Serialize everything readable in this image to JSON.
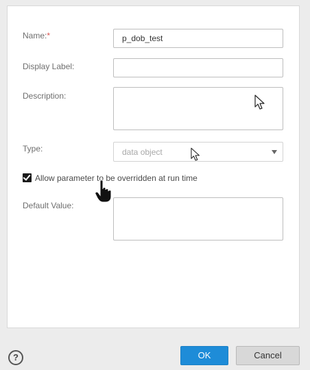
{
  "form": {
    "name_label": "Name:",
    "name_required_marker": "*",
    "name_value": "p_dob_test",
    "display_label_label": "Display Label:",
    "display_label_value": "",
    "description_label": "Description:",
    "description_value": "",
    "type_label": "Type:",
    "type_value": "data object",
    "allow_override_checked": true,
    "allow_override_label": "Allow parameter to be overridden at run time",
    "default_value_label": "Default Value:",
    "default_value_value": ""
  },
  "footer": {
    "help_label": "?",
    "ok_label": "OK",
    "cancel_label": "Cancel"
  },
  "colors": {
    "accent": "#1e8cd8",
    "required": "#d9534f"
  },
  "icons": {
    "help": "help-circle-icon",
    "dropdown": "caret-down-icon",
    "checkbox": "checkbox-checked-icon"
  }
}
